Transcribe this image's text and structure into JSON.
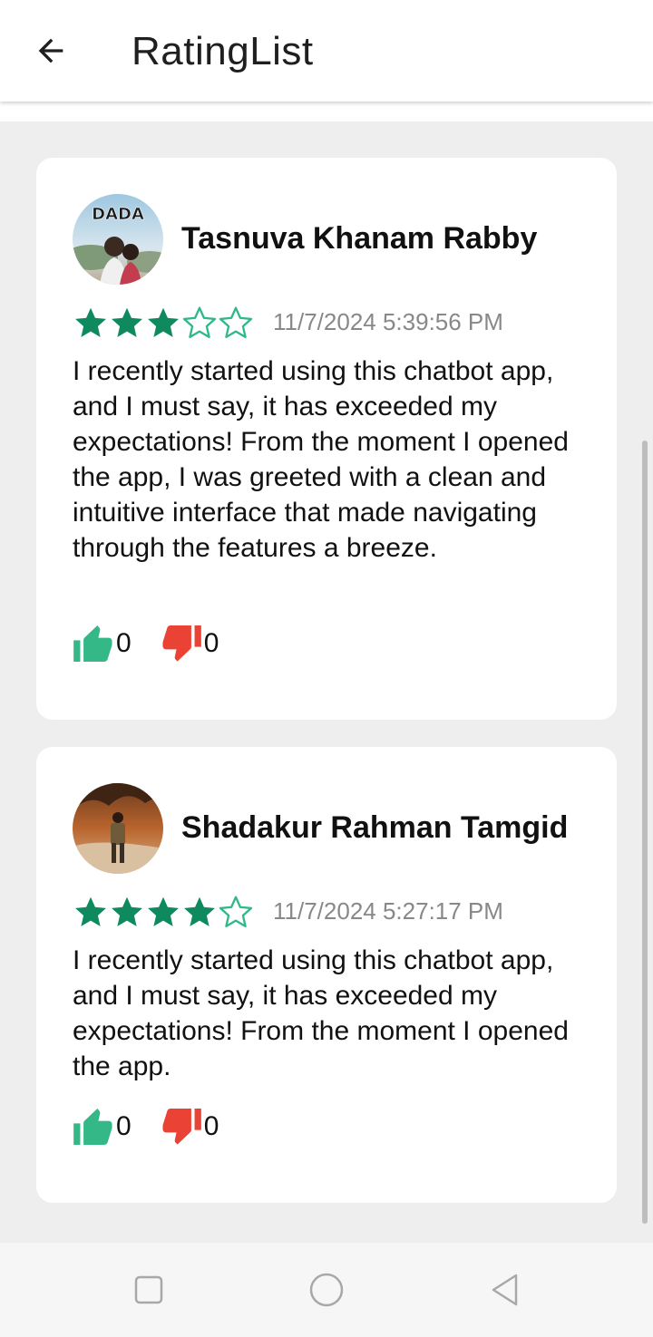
{
  "appbar": {
    "title": "RatingList",
    "back_icon": "arrow-left-icon"
  },
  "colors": {
    "star_filled": "#0f8a5f",
    "star_empty_stroke": "#2fb98a",
    "like": "#35b887",
    "dislike": "#ea4335",
    "timestamp": "#888888"
  },
  "reviews": [
    {
      "name": "Tasnuva Khanam Rabby",
      "avatar_label": "DADA",
      "rating": 3,
      "max_rating": 5,
      "timestamp": "11/7/2024 5:39:56 PM",
      "text": "I recently started using this chatbot app, and I must say, it has exceeded my expectations! From the moment I opened the app, I was greeted with a clean and intuitive interface that made navigating through the features a breeze.",
      "likes": "0",
      "dislikes": "0"
    },
    {
      "name": "Shadakur Rahman Tamgid",
      "rating": 4,
      "max_rating": 5,
      "timestamp": "11/7/2024 5:27:17 PM",
      "text": "I recently started using this chatbot app, and I must say, it has exceeded my expectations! From the moment I opened the app.",
      "likes": "0",
      "dislikes": "0"
    }
  ],
  "navbar": {
    "icons": [
      "square-recents-icon",
      "circle-home-icon",
      "triangle-back-icon"
    ]
  }
}
